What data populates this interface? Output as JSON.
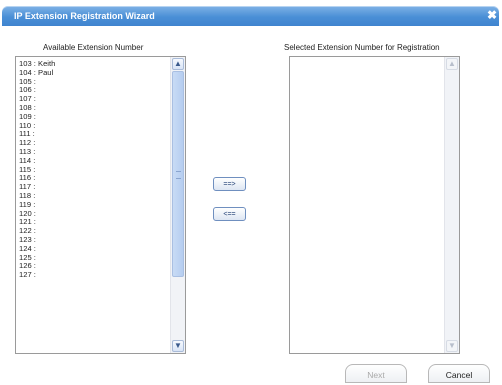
{
  "dialog": {
    "title": "IP Extension Registration Wizard",
    "close_glyph": "✖"
  },
  "available": {
    "header": "Available Extension Number",
    "items": [
      "103 : Keith",
      "104 : Paul",
      "105 :",
      "106 :",
      "107 :",
      "108 :",
      "109 :",
      "110 :",
      "111 :",
      "112 :",
      "113 :",
      "114 :",
      "115 :",
      "116 :",
      "117 :",
      "118 :",
      "119 :",
      "120 :",
      "121 :",
      "122 :",
      "123 :",
      "124 :",
      "125 :",
      "126 :",
      "127 :"
    ]
  },
  "selected": {
    "header": "Selected Extension Number for Registration",
    "items": []
  },
  "move": {
    "add_label": "==>",
    "remove_label": "<=="
  },
  "footer": {
    "next_label": "Next",
    "cancel_label": "Cancel"
  },
  "icons": {
    "scroll_up": "scroll-up-arrow-icon",
    "scroll_down": "scroll-down-arrow-icon"
  },
  "colors": {
    "title_bar": "#4a8fd6",
    "scrollbar_thumb": "#b5cdf0"
  }
}
